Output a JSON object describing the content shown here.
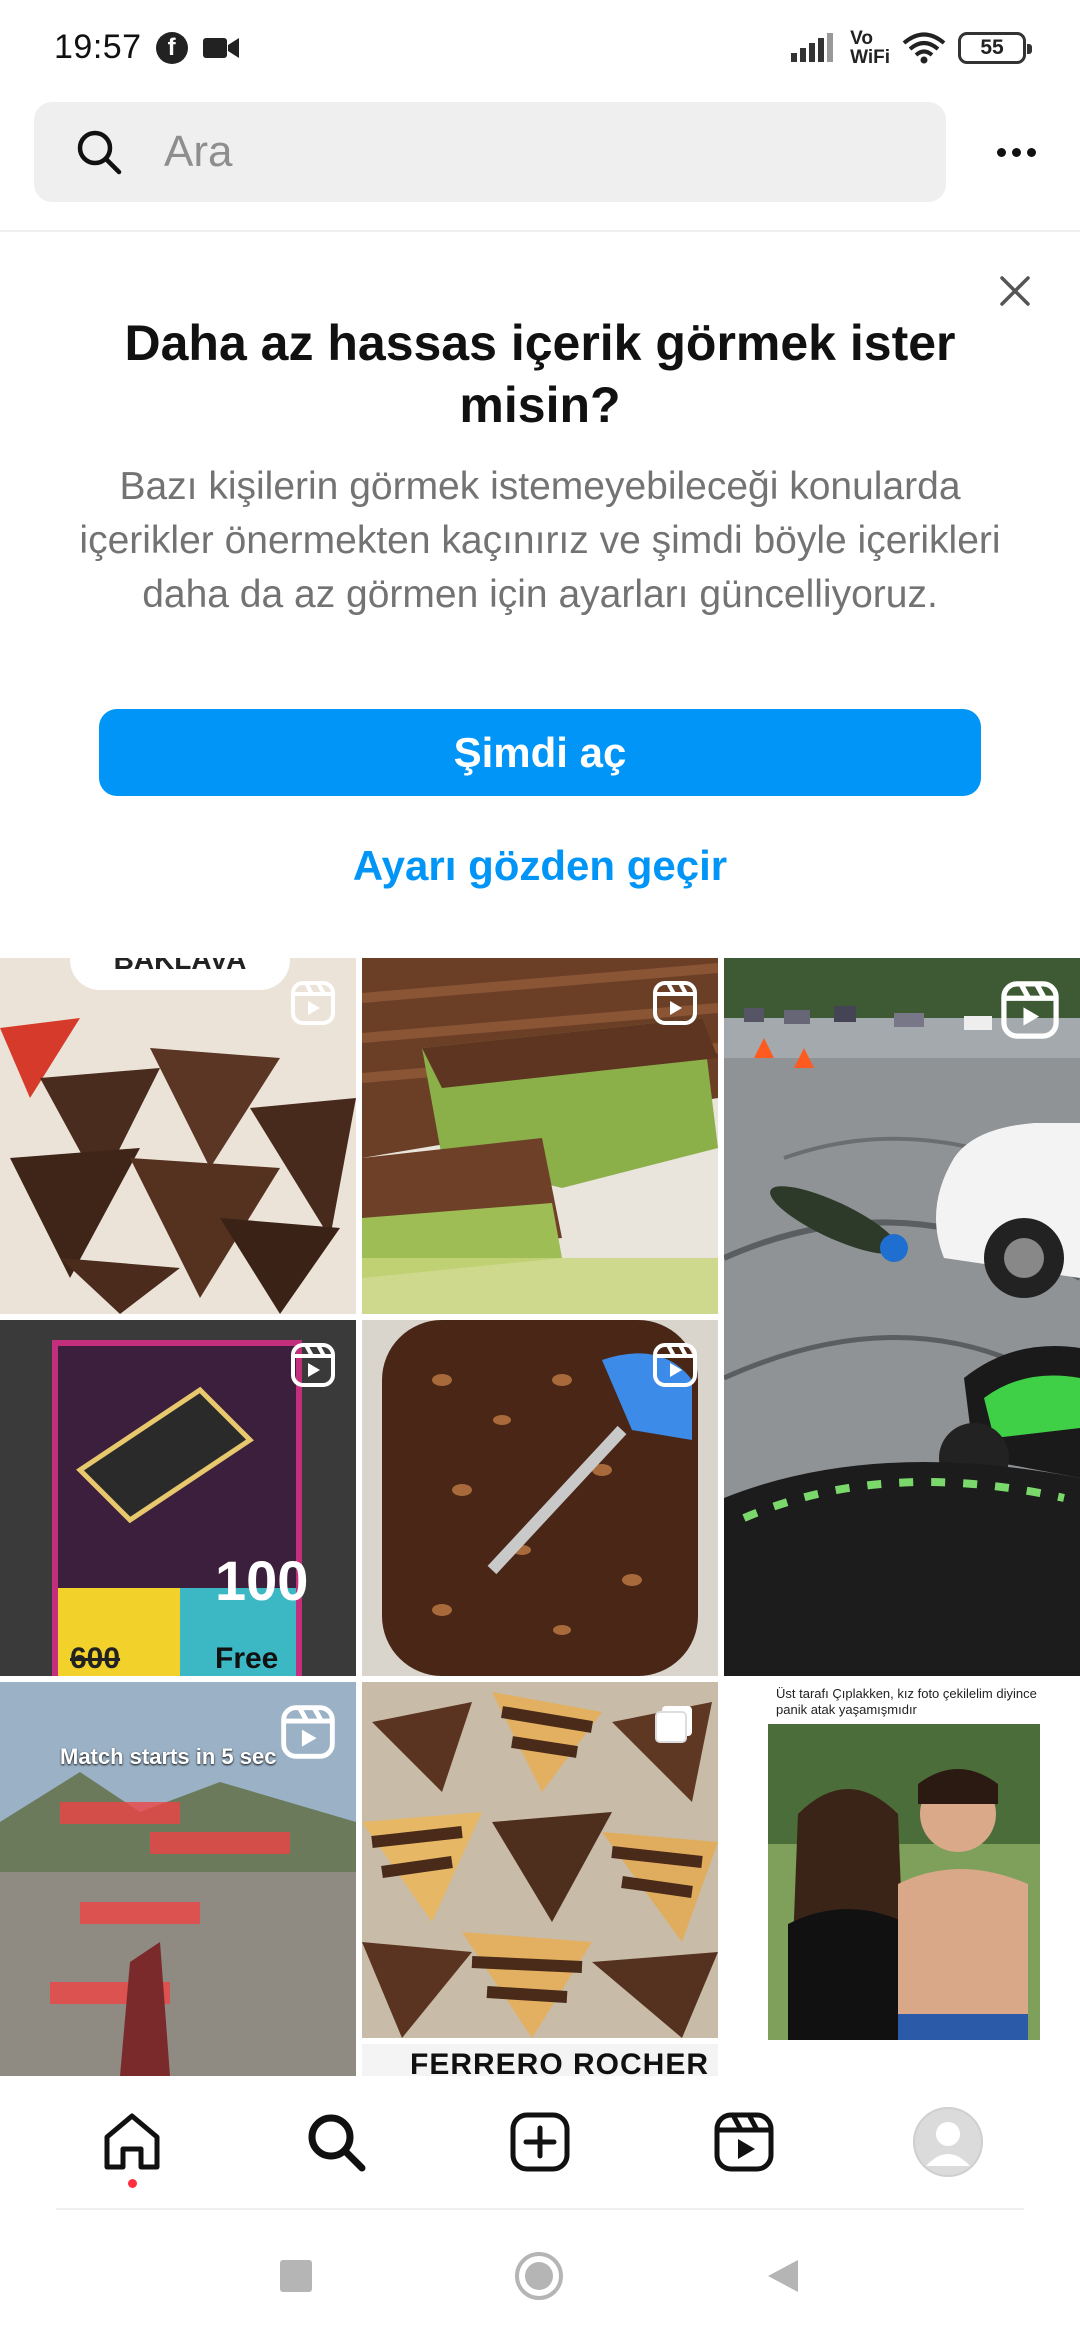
{
  "status_bar": {
    "time": "19:57",
    "network_label_top": "Vo",
    "network_label_bottom": "WiFi",
    "battery": "55"
  },
  "search": {
    "placeholder": "Ara"
  },
  "sensitive_card": {
    "title": "Daha az hassas içerik görmek ister misin?",
    "body": "Bazı kişilerin görmek istemeyebileceği konularda içerikler önermekten kaçınırız ve şimdi böyle içerikleri daha da az görmen için ayarları güncelliyoruz.",
    "primary_button": "Şimdi aç",
    "secondary_link": "Ayarı gözden geçir"
  },
  "grid_texts": {
    "tile_1_banner": "BAKLAVA",
    "tile_4_value": "100",
    "tile_4_price": "600",
    "tile_4_free": "Free",
    "tile_7_overlay": "Match starts in 5 sec",
    "tile_9_caption": "Üst tarafı Çıplakken, kız foto çekilelim diyince panik atak yaşamışmıdır",
    "tile_8_bottom": "FERRERO ROCHER"
  },
  "colors": {
    "accent": "#0095f6",
    "notification_dot": "#ff3040",
    "search_bg": "#efefef",
    "muted_text": "#737373"
  },
  "icons": {
    "bottom_nav": [
      "home-icon",
      "search-icon",
      "create-icon",
      "reels-icon",
      "profile-avatar"
    ],
    "system_nav": [
      "recents-square",
      "home-circle",
      "back-triangle"
    ]
  }
}
